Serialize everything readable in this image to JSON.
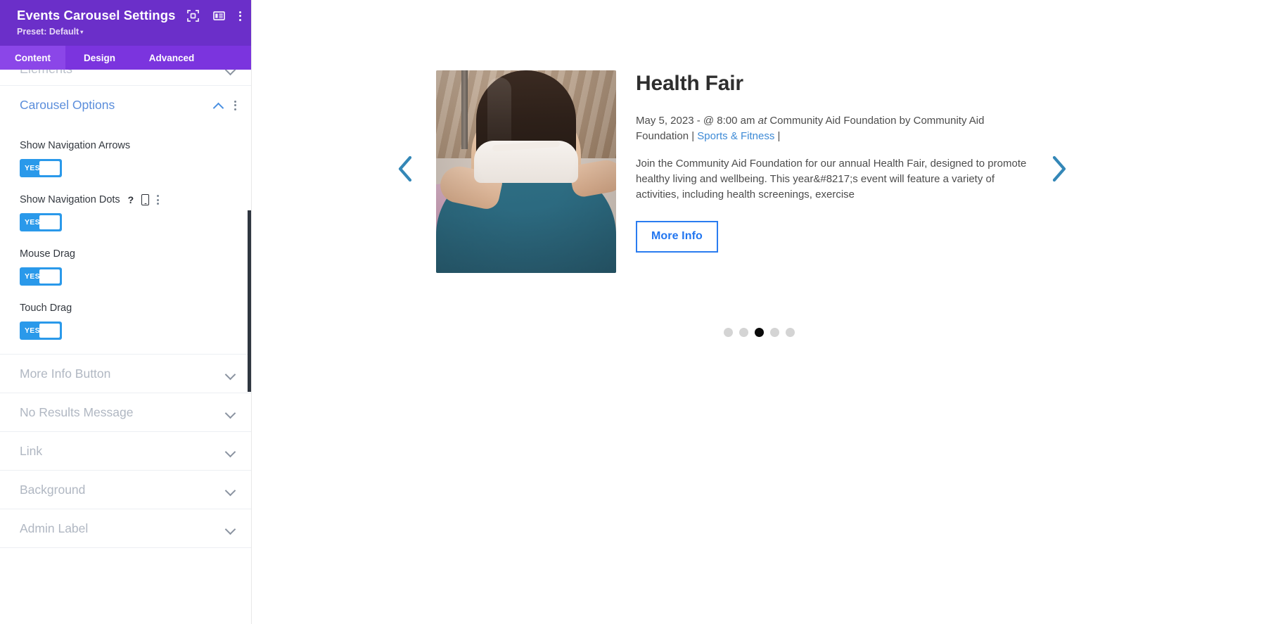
{
  "panel": {
    "title": "Events Carousel Settings",
    "preset_label": "Preset: Default",
    "preset_caret": "▾",
    "header_icons": [
      {
        "name": "focus-target-icon"
      },
      {
        "name": "panel-layout-icon"
      },
      {
        "name": "kebab-menu-icon"
      }
    ],
    "tabs": [
      {
        "label": "Content",
        "active": true
      },
      {
        "label": "Design",
        "active": false
      },
      {
        "label": "Advanced",
        "active": false
      }
    ],
    "cut_section_label": "Elements",
    "carousel_section": {
      "title": "Carousel Options",
      "expanded": true,
      "fields": [
        {
          "label": "Show Navigation Arrows",
          "value": "YES",
          "has_help": false,
          "has_responsive": false,
          "has_kebab": false
        },
        {
          "label": "Show Navigation Dots",
          "value": "YES",
          "has_help": true,
          "has_responsive": true,
          "has_kebab": true,
          "help_glyph": "?"
        },
        {
          "label": "Mouse Drag",
          "value": "YES",
          "has_help": false,
          "has_responsive": false,
          "has_kebab": false
        },
        {
          "label": "Touch Drag",
          "value": "YES",
          "has_help": false,
          "has_responsive": false,
          "has_kebab": false
        }
      ]
    },
    "collapsed_sections": [
      {
        "label": "More Info Button"
      },
      {
        "label": "No Results Message"
      },
      {
        "label": "Link"
      },
      {
        "label": "Background"
      },
      {
        "label": "Admin Label"
      }
    ]
  },
  "carousel": {
    "prev_arrow": "‹",
    "next_arrow": "›",
    "slide": {
      "title": "Health Fair",
      "meta_date": "May 5, 2023 - @ 8:00 am ",
      "meta_at": "at",
      "meta_venue": " Community Aid Foundation by Community Aid Foundation | ",
      "meta_category": "Sports & Fitness",
      "meta_tail": " |",
      "description": "Join the Community Aid Foundation for our annual Health Fair, designed to promote healthy living and wellbeing. This year&#8217;s event will feature a variety of activities, including health screenings, exercise",
      "button_label": "More Info",
      "image_alt": "woman-in-yoga-pose-on-mat"
    },
    "dots": [
      {
        "active": false
      },
      {
        "active": false
      },
      {
        "active": true
      },
      {
        "active": false
      },
      {
        "active": false
      }
    ]
  },
  "colors": {
    "panel_header": "#6B2FC9",
    "panel_tabs": "#7B34DE",
    "tab_active": "#8B46E8",
    "toggle_on": "#2a99ea",
    "link": "#3d8ad6",
    "button_border": "#2a7cf0",
    "arrow": "#3487b7",
    "dot_active": "#0a0a0a",
    "dot_inactive": "#d4d4d4",
    "section_open_label": "#5a8ddb",
    "section_label": "#b0b7c2"
  }
}
